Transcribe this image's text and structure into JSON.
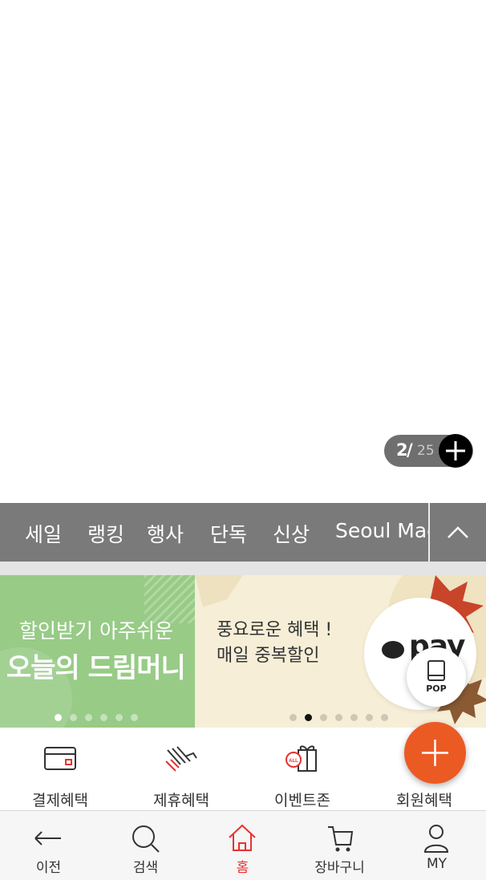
{
  "viewer": {
    "current_page": "2",
    "separator": "/",
    "total_pages": "25"
  },
  "categories": {
    "items": [
      "세일",
      "랭킹",
      "행사",
      "단독",
      "신상",
      "Seoul Mac"
    ]
  },
  "banners": {
    "left": {
      "line1": "할인받기 아주쉬운",
      "line2": "오늘의 드림머니"
    },
    "right": {
      "line1": "풍요로운 혜택 !",
      "line2": "매일 중복할인",
      "brand": "pay"
    },
    "pop_label": "POP"
  },
  "benefits": {
    "items": [
      {
        "label": "결제혜택",
        "icon": "card-icon"
      },
      {
        "label": "제휴혜택",
        "icon": "handshake-icon"
      },
      {
        "label": "이벤트존",
        "icon": "gift-icon",
        "badge": "ALL"
      },
      {
        "label": "회원혜택",
        "icon": "member-gift-icon"
      }
    ]
  },
  "nav": {
    "items": [
      {
        "label": "이전",
        "icon": "back-arrow-icon"
      },
      {
        "label": "검색",
        "icon": "search-icon"
      },
      {
        "label": "홈",
        "icon": "home-icon",
        "active": true
      },
      {
        "label": "장바구니",
        "icon": "cart-icon"
      },
      {
        "label": "MY",
        "icon": "person-icon"
      }
    ]
  },
  "colors": {
    "category_bar": "#7a7a7a",
    "banner_green": "#97cb86",
    "banner_cream": "#f6eed7",
    "fab_orange": "#ec5a24",
    "active_red": "#e8312f"
  }
}
